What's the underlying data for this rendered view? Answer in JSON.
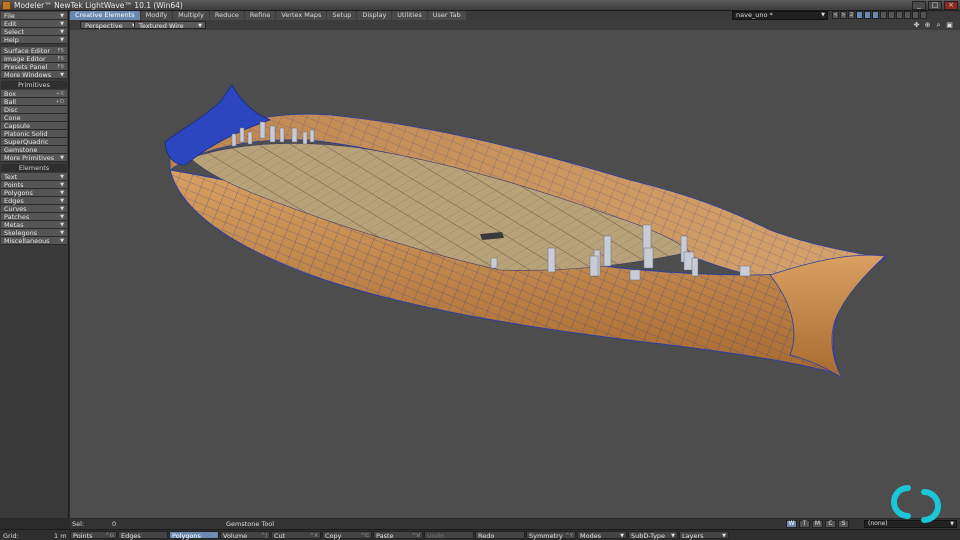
{
  "window": {
    "title": "Modeler™ NewTek LightWave™ 10.1 (Win64)",
    "min": "_",
    "max": "□",
    "close": "×"
  },
  "tabs": [
    {
      "label": "Creative Elements",
      "active": true
    },
    {
      "label": "Modify"
    },
    {
      "label": "Multiply"
    },
    {
      "label": "Reduce"
    },
    {
      "label": "Refine"
    },
    {
      "label": "Vertex Maps"
    },
    {
      "label": "Setup"
    },
    {
      "label": "Display"
    },
    {
      "label": "Utilities"
    },
    {
      "label": "User Tab"
    }
  ],
  "layer_selector": {
    "value": "nave_uno *"
  },
  "layer_tools": [
    "<",
    ">",
    "2",
    "",
    "",
    "",
    "",
    "",
    "",
    "",
    "",
    ""
  ],
  "left_menu": [
    {
      "label": "File",
      "dd": "▼"
    },
    {
      "label": "Edit",
      "dd": "▼"
    },
    {
      "label": "Select",
      "dd": "▼"
    },
    {
      "label": "Help",
      "dd": "▼"
    }
  ],
  "windows_menu": [
    {
      "label": "Surface Editor",
      "shortcut": "F5"
    },
    {
      "label": "Image Editor",
      "shortcut": "F6"
    },
    {
      "label": "Presets Panel",
      "shortcut": "F8"
    },
    {
      "label": "More Windows",
      "dd": "▼"
    }
  ],
  "primitives_header": "Primitives",
  "primitives": [
    {
      "label": "Box",
      "shortcut": "+X"
    },
    {
      "label": "Ball",
      "shortcut": "+O"
    },
    {
      "label": "Disc"
    },
    {
      "label": "Cone"
    },
    {
      "label": "Capsule"
    },
    {
      "label": "Platonic Solid"
    },
    {
      "label": "SuperQuadric"
    },
    {
      "label": "Gemstone"
    },
    {
      "label": "More Primitives",
      "dd": "▼"
    }
  ],
  "elements_header": "Elements",
  "elements": [
    {
      "label": "Text",
      "dd": "▼"
    },
    {
      "label": "Points",
      "dd": "▼"
    },
    {
      "label": "Polygons",
      "dd": "▼"
    },
    {
      "label": "Edges",
      "dd": "▼"
    },
    {
      "label": "Curves",
      "dd": "▼"
    },
    {
      "label": "Patches",
      "dd": "▼"
    },
    {
      "label": "Metas",
      "dd": "▼"
    },
    {
      "label": "Skelegons",
      "dd": "▼"
    },
    {
      "label": "Miscellaneous",
      "dd": "▼"
    }
  ],
  "viewport": {
    "view_type": "Perspective",
    "render_mode": "Textured Wire",
    "arrow": "▼",
    "icons": [
      "✥",
      "⊕",
      "⌕",
      "▣"
    ]
  },
  "status": {
    "sel_label": "Sel:",
    "sel_count": "0",
    "tool_name": "Gemstone Tool"
  },
  "view_buttons": [
    {
      "label": "W",
      "on": true
    },
    {
      "label": "T"
    },
    {
      "label": "M"
    },
    {
      "label": "C"
    },
    {
      "label": "S"
    }
  ],
  "none_dropdown": {
    "value": "(none)"
  },
  "bottom": {
    "grid_label": "Grid:",
    "grid_value": "1 m",
    "buttons": [
      {
        "label": "Points",
        "shortcut": "^G"
      },
      {
        "label": "Edges",
        "shortcut": ""
      },
      {
        "label": "Polygons",
        "shortcut": "^H",
        "on": true
      },
      {
        "label": "Volume",
        "shortcut": "^J"
      },
      {
        "label": "Cut",
        "shortcut": "^X"
      },
      {
        "label": "Copy",
        "shortcut": "^C"
      },
      {
        "label": "Paste",
        "shortcut": "^V"
      },
      {
        "label": "Undo",
        "shortcut": "",
        "disabled": true
      },
      {
        "label": "Redo",
        "shortcut": ""
      },
      {
        "label": "Symmetry",
        "shortcut": "^Y"
      },
      {
        "label": "Modes",
        "dd": "▼"
      },
      {
        "label": "SubD-Type",
        "dd": "▼"
      },
      {
        "label": "Layers",
        "dd": "▼"
      }
    ]
  },
  "colors": {
    "accent": "#6a89b0",
    "viewport_bg": "#4d4d4d",
    "hull_wood": "#c98d4a",
    "wire": "#2a3fa0",
    "logo": "#19c7d6"
  }
}
